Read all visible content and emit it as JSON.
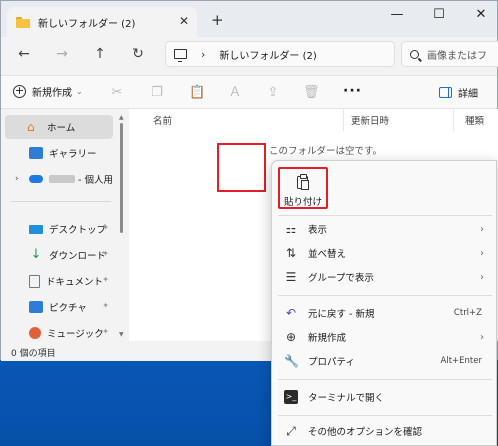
{
  "window": {
    "tab_title": "新しいフォルダー (2)",
    "tab_close": "✕",
    "new_tab": "+",
    "minimize": "—",
    "maximize": "☐",
    "close": "✕"
  },
  "nav": {
    "back": "←",
    "forward": "→",
    "up": "↑",
    "refresh": "↻",
    "chevron": "›",
    "address": "新しいフォルダー (2)",
    "search_placeholder": "画像またはフ"
  },
  "toolbar": {
    "new_label": "新規作成",
    "new_plus": "+",
    "new_chevron": "⌄",
    "more": "···",
    "details_label": "詳細",
    "icons": [
      "cut-icon",
      "copy-icon",
      "paste-icon",
      "rename-icon",
      "share-icon",
      "delete-icon"
    ]
  },
  "sidebar": {
    "items": [
      {
        "label": "ホーム",
        "icon": "home-icon"
      },
      {
        "label": "ギャラリー",
        "icon": "gallery-icon"
      },
      {
        "label": "- 個人用",
        "icon": "onedrive-icon"
      },
      {
        "label": "デスクトップ",
        "icon": "desktop-icon"
      },
      {
        "label": "ダウンロード",
        "icon": "download-icon"
      },
      {
        "label": "ドキュメント",
        "icon": "document-icon"
      },
      {
        "label": "ピクチャ",
        "icon": "pictures-icon"
      },
      {
        "label": "ミュージック",
        "icon": "music-icon"
      }
    ],
    "pin": "📌",
    "expand_chevron": "›"
  },
  "content": {
    "columns": [
      "名前",
      "更新日時",
      "種類"
    ],
    "empty_message": "このフォルダーは空です。"
  },
  "status": {
    "item_count": "0 個の項目"
  },
  "context_menu": {
    "paste_label": "貼り付け",
    "items": [
      {
        "label": "表示",
        "icon": "view-icon",
        "shortcut": "",
        "submenu": true
      },
      {
        "label": "並べ替え",
        "icon": "sort-icon",
        "shortcut": "",
        "submenu": true
      },
      {
        "label": "グループで表示",
        "icon": "group-icon",
        "shortcut": "",
        "submenu": true
      },
      {
        "label": "元に戻す - 新規",
        "icon": "undo-icon",
        "shortcut": "Ctrl+Z",
        "submenu": false
      },
      {
        "label": "新規作成",
        "icon": "new-icon",
        "shortcut": "",
        "submenu": true
      },
      {
        "label": "プロパティ",
        "icon": "properties-icon",
        "shortcut": "Alt+Enter",
        "submenu": false
      },
      {
        "label": "ターミナルで開く",
        "icon": "terminal-icon",
        "shortcut": "",
        "submenu": false
      },
      {
        "label": "その他のオプションを確認",
        "icon": "more-options-icon",
        "shortcut": "",
        "submenu": false
      }
    ],
    "chevron": "›"
  },
  "colors": {
    "accent": "#1a6ed0",
    "highlight_box": "#e01f26",
    "desktop": "#0b5fc4"
  }
}
